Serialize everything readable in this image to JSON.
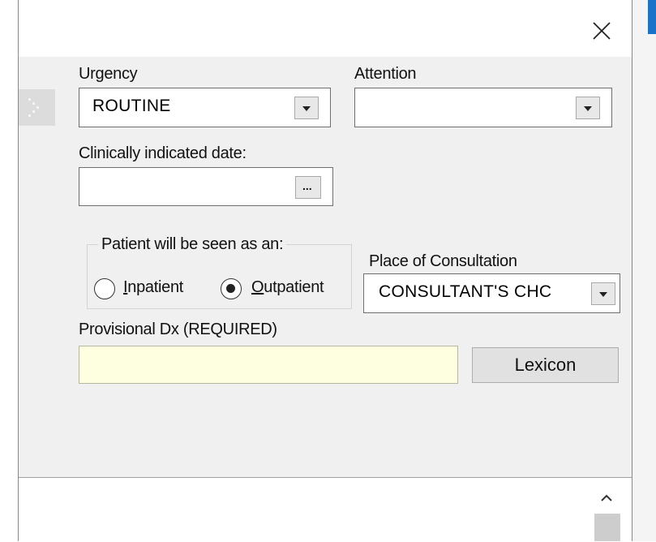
{
  "window": {
    "close_icon": "close-icon"
  },
  "form": {
    "urgency": {
      "label": "Urgency",
      "value": "ROUTINE"
    },
    "attention": {
      "label": "Attention",
      "value": ""
    },
    "clinically_indicated_date": {
      "label": "Clinically indicated date:",
      "value": "",
      "button_label": "..."
    },
    "patient_seen_as": {
      "legend": "Patient will be seen as an:",
      "options": [
        {
          "prefix": "",
          "mnemonic": "I",
          "rest": "npatient",
          "selected": false
        },
        {
          "prefix": "",
          "mnemonic": "O",
          "rest": "utpatient",
          "selected": true
        }
      ]
    },
    "place_of_consultation": {
      "label": "Place of Consultation",
      "value": "CONSULTANT'S CHC"
    },
    "provisional_dx": {
      "label": "Provisional Dx (REQUIRED)",
      "value": "",
      "field_color": "#fefee0"
    },
    "lexicon_button": {
      "label": "Lexicon"
    }
  },
  "icons": {
    "dropdown": "chevron-down-icon",
    "scroll_up": "chevron-up-icon",
    "grip": "drag-grip-icon"
  }
}
